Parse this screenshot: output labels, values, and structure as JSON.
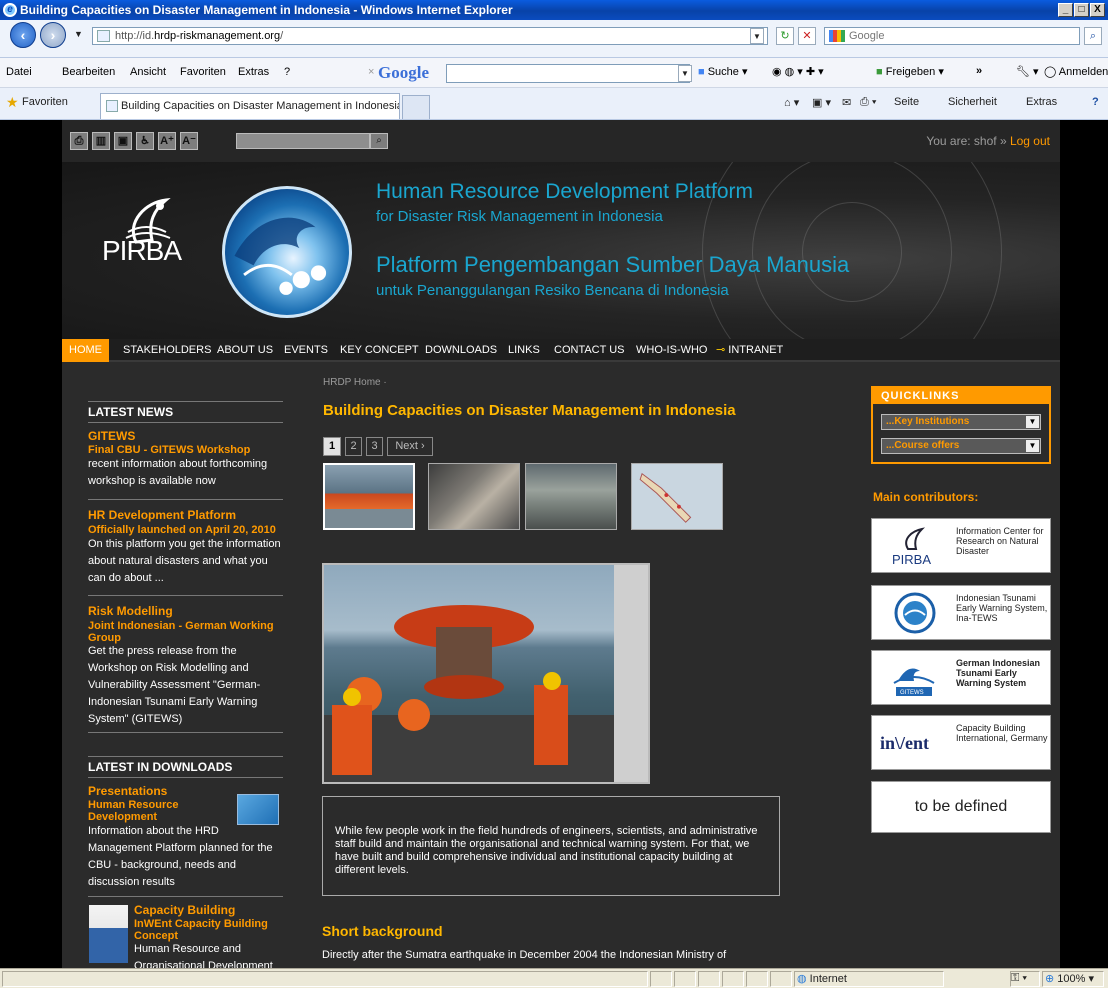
{
  "window": {
    "title": "Building Capacities on Disaster Management in Indonesia - Windows Internet Explorer",
    "minimize": "_",
    "maximize": "□",
    "close": "X"
  },
  "address_bar": {
    "url_prefix": "http://id.",
    "url_domain": "hrdp-riskmanagement.org",
    "url_suffix": "/",
    "search_placeholder": "Google"
  },
  "menubar": {
    "items": [
      "Datei",
      "Bearbeiten",
      "Ansicht",
      "Favoriten",
      "Extras",
      "?"
    ],
    "google_logo": "Google",
    "suche": "Suche",
    "freigeben": "Freigeben",
    "more": "»",
    "anmelden": "Anmelden"
  },
  "favbar": {
    "favorites": "Favoriten",
    "tab_title": "Building Capacities on Disaster Management in Indonesia",
    "commands": [
      "Seite",
      "Sicherheit",
      "Extras"
    ]
  },
  "site_toolbar": {
    "icons": [
      "print-icon",
      "sitemap-icon",
      "window-icon",
      "accessibility-icon",
      "A⁺",
      "A⁻"
    ],
    "search_value": "",
    "you_are": "You are: shof » ",
    "logout": "Log out"
  },
  "banner": {
    "logo_text": "PIRBA",
    "en_title": "Human Resource Development Platform",
    "en_sub": "for Disaster Risk Management in Indonesia",
    "id_title": "Platform Pengembangan Sumber Daya Manusia",
    "id_sub": "untuk Penanggulangan Resiko Bencana di Indonesia"
  },
  "nav": {
    "items": [
      "HOME",
      "STAKEHOLDERS",
      "ABOUT US",
      "EVENTS",
      "KEY CONCEPT",
      "DOWNLOADS",
      "LINKS",
      "CONTACT US",
      "WHO-IS-WHO",
      "INTRANET"
    ]
  },
  "breadcrumb": "HRDP Home  ·",
  "latest_news": {
    "heading": "LATEST NEWS",
    "items": [
      {
        "title": "GITEWS",
        "subtitle": "Final CBU - GITEWS Workshop",
        "text": "recent information about forthcoming workshop is available now"
      },
      {
        "title": "HR Development Platform",
        "subtitle": "Officially launched on April 20, 2010",
        "text": "On this platform you get the information about natural disasters and what you can do about ..."
      },
      {
        "title": "Risk Modelling",
        "subtitle": "Joint Indonesian - German Working Group",
        "text": "Get the press release from the Workshop on Risk Modelling and Vulnerability Assessment \"German-Indonesian Tsunami Early Warning System\" (GITEWS)"
      }
    ]
  },
  "latest_downloads": {
    "heading": "LATEST IN DOWNLOADS",
    "items": [
      {
        "title": "Presentations",
        "subtitle": "Human Resource Development",
        "text": "Information about the HRD Management Platform planned for the CBU - background, needs and discussion results"
      },
      {
        "title": "Capacity Building",
        "subtitle": "InWEnt Capacity Building Concept",
        "text": "Human Resource and Organisational Development in ..."
      }
    ]
  },
  "main": {
    "heading": "Building Capacities on Disaster Management in Indonesia",
    "pager": [
      "1",
      "2",
      "3",
      "Next ›"
    ],
    "thumbnails": [
      "buoy-photo-thumb",
      "meeting-photo-thumb",
      "control-room-thumb",
      "map-thumb"
    ],
    "caption": "While few people work in the field hundreds of engineers, scientists, and administrative staff build and maintain the organisational and technical warning system. For that, we have built and build comprehensive individual and institutional capacity building at different levels.",
    "short_bg_heading": "Short background",
    "short_bg_text": "Directly after the Sumatra earthquake in December 2004 the Indonesian Ministry of"
  },
  "quicklinks": {
    "heading": "QUICKLINKS",
    "select1": "...Key Institutions",
    "select2": "...Course offers"
  },
  "contributors": {
    "heading": "Main contributors:",
    "items": [
      {
        "logo": "PIRBA",
        "text": "Information Center for Research on Natural Disaster"
      },
      {
        "logo": "",
        "text": "Indonesian Tsunami Early Warning System, Ina-TEWS"
      },
      {
        "logo": "GITEWS",
        "text": "German Indonesian Tsunami Early Warning System"
      },
      {
        "logo": "in\\/ent",
        "text": "Capacity Building International, Germany"
      }
    ],
    "tbd": "to be defined"
  },
  "statusbar": {
    "zone": "Internet",
    "zoom": "100%"
  },
  "colors": {
    "accent": "#ff9a00",
    "heading": "#ffb700",
    "banner_text": "#1aa6cf",
    "site_bg": "#2b2b2b"
  }
}
